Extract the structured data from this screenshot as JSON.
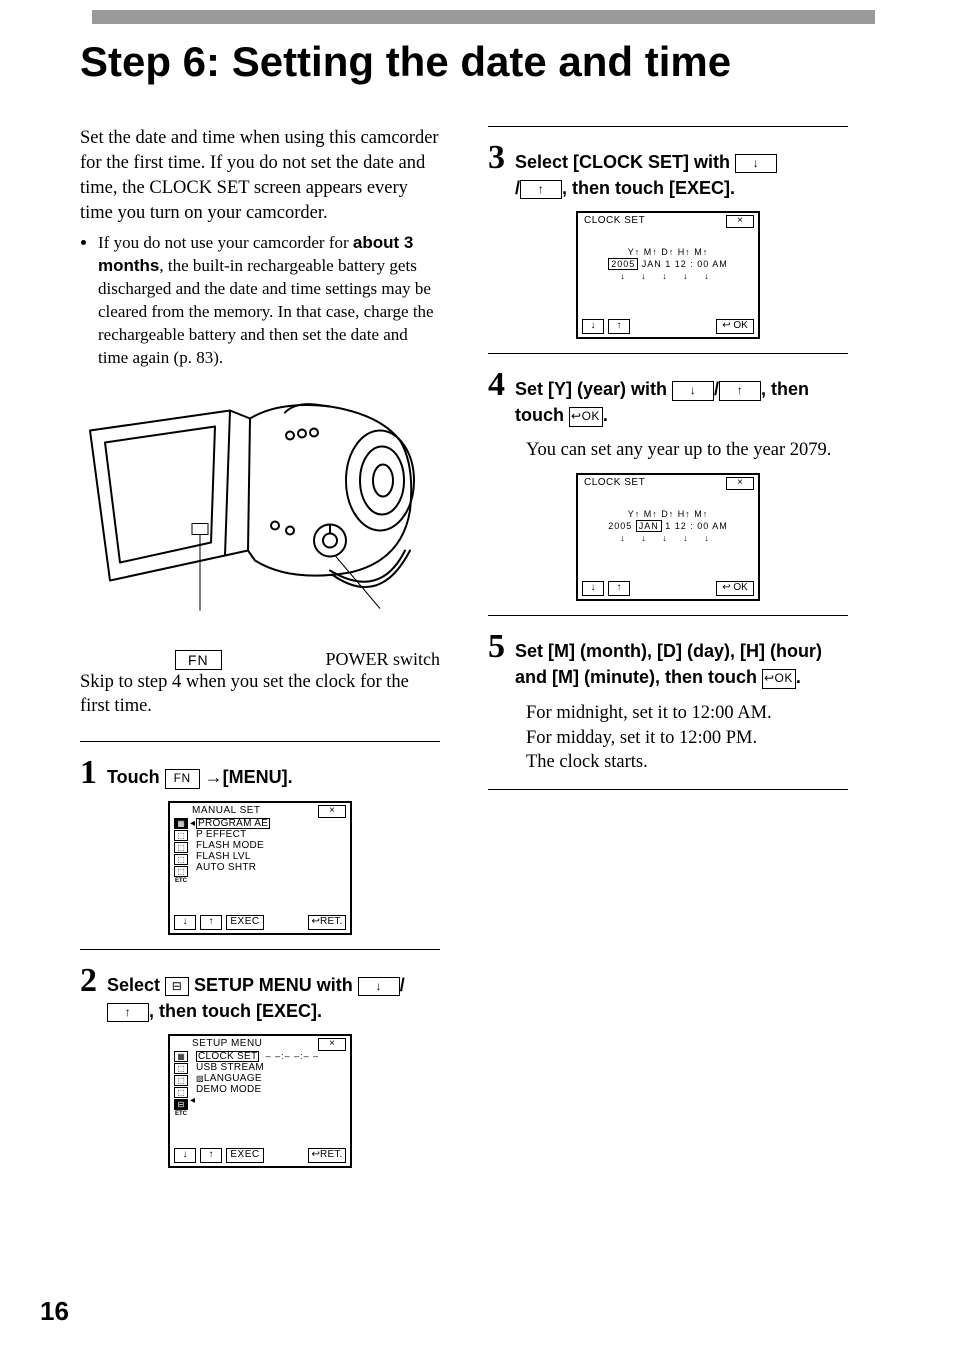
{
  "page_number": "16",
  "heading": "Step 6: Setting the date and time",
  "intro": "Set the date and time when using this camcorder for the first time. If you do not set the date and time, the CLOCK SET screen appears every time you turn on your camcorder.",
  "bullet": {
    "pre": "If you do not use your camcorder for ",
    "bold": "about 3 months",
    "post": ", the built-in rechargeable battery gets discharged and the date and time settings may be cleared from the memory. In that case, charge the rechargeable battery and then set the date and time again (p. 83)."
  },
  "figure": {
    "fn_label": "FN",
    "power_label": "POWER switch"
  },
  "post_figure": "Skip to step 4 when you set the clock for the first time.",
  "step1": {
    "num": "1",
    "t1": "Touch ",
    "fn": "FN",
    "t2": " →[MENU].",
    "lcd": {
      "title": "MANUAL SET",
      "items": [
        "PROGRAM AE",
        "P EFFECT",
        "FLASH MODE",
        "FLASH LVL",
        "AUTO SHTR"
      ],
      "exec": "EXEC",
      "ret": "RET."
    }
  },
  "step2": {
    "num": "2",
    "t1": "Select ",
    "t2": " SETUP MENU with ",
    "t3": ", then touch [EXEC].",
    "lcd": {
      "title": "SETUP MENU",
      "right_val": "– –:– –:– –",
      "items": [
        "CLOCK SET",
        "USB STREAM",
        "LANGUAGE",
        "DEMO MODE"
      ],
      "exec": "EXEC",
      "ret": "RET."
    }
  },
  "step3": {
    "num": "3",
    "t1": "Select [CLOCK SET] with ",
    "t2": ", then touch [EXEC].",
    "lcd": {
      "title": "CLOCK SET",
      "fieldrow": "Y↑  M↑  D↑  H↑  M↑",
      "valrow_pre": "",
      "year": "2005",
      "valrow_post": " JAN   1   12 : 00 AM",
      "arrrow": "↓  ↓  ↓  ↓  ↓",
      "ok": "OK"
    }
  },
  "step4": {
    "num": "4",
    "t1": "Set [Y] (year) with ",
    "t2": ", then touch ",
    "ok": "OK",
    "note": "You can set any year up to the year 2079.",
    "lcd": {
      "title": "CLOCK SET",
      "fieldrow": "Y↑  M↑  D↑  H↑  M↑",
      "valrow_pre": "2005 ",
      "month": "JAN",
      "valrow_post": "   1   12 : 00 AM",
      "arrrow": "↓  ↓  ↓  ↓  ↓",
      "ok": "OK"
    }
  },
  "step5": {
    "num": "5",
    "t1": "Set [M] (month), [D] (day), [H] (hour) and [M] (minute), then touch ",
    "ok": "OK",
    "note1": "For midnight, set it to 12:00 AM.",
    "note2": "For midday, set it to 12:00 PM.",
    "note3": "The clock starts."
  },
  "glyph": {
    "down": "↓",
    "up": "↑",
    "x": "×",
    "return": "↩",
    "right_tri": "◂"
  }
}
